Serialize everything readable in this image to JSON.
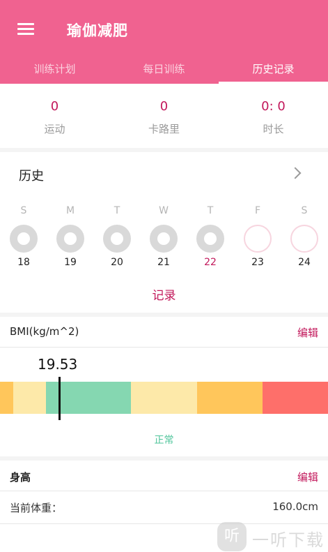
{
  "app": {
    "title": "瑜伽减肥"
  },
  "tabs": [
    {
      "label": "训练计划"
    },
    {
      "label": "每日训练"
    },
    {
      "label": "历史记录"
    }
  ],
  "stats": [
    {
      "value": "0",
      "label": "运动"
    },
    {
      "value": "0",
      "label": "卡路里"
    },
    {
      "value": "0: 0",
      "label": "时长"
    }
  ],
  "history": {
    "title": "历史",
    "week_days": [
      "S",
      "M",
      "T",
      "W",
      "T",
      "F",
      "S"
    ],
    "dates": [
      "18",
      "19",
      "20",
      "21",
      "22",
      "23",
      "24"
    ],
    "today": "22",
    "record_label": "记录"
  },
  "bmi": {
    "label": "BMI(kg/m^2)",
    "edit_label": "编辑",
    "value": "19.53",
    "status": "正常",
    "colors": {
      "orange": "#ffc65b",
      "pale_yellow": "#fde9a9",
      "green": "#85d7b1",
      "yellow": "#fde9a9",
      "red": "#fe6f6a"
    }
  },
  "body": {
    "height_label": "身高",
    "edit_label": "编辑",
    "weight_label": "当前体重：",
    "weight_value": "160.0cm"
  },
  "watermark": {
    "logo_glyph": "听",
    "text": "一听下载"
  },
  "theme": {
    "accent": "#f06290",
    "accent_dark": "#c2185b"
  }
}
